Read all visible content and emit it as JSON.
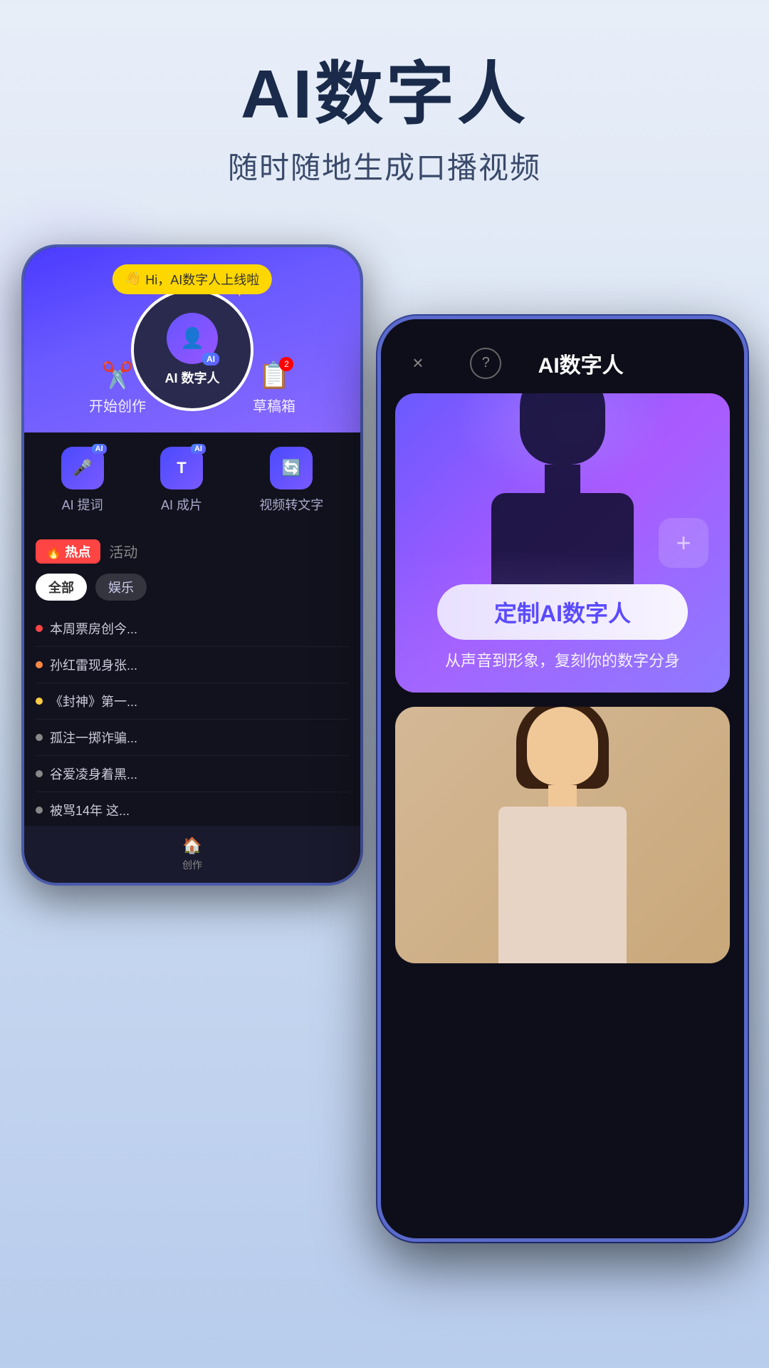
{
  "hero": {
    "title": "AI数字人",
    "subtitle": "随时随地生成口播视频"
  },
  "back_phone": {
    "notification": {
      "emoji": "👋",
      "text": "Hi，AI数字人上线啦"
    },
    "ai_circle_label": "AI 数字人",
    "main_actions": [
      {
        "icon": "✂️",
        "label": "开始创作"
      },
      {
        "icon": "📝",
        "label": "草稿箱",
        "badge": "2"
      }
    ],
    "tools": [
      {
        "icon": "🎤",
        "label": "AI 提词",
        "has_ai_badge": true
      },
      {
        "icon": "T",
        "label": "AI 成片",
        "has_ai_badge": true
      },
      {
        "icon": "🔄",
        "label": "视频转文字",
        "has_ai_badge": false
      }
    ],
    "hot_section": {
      "hot_label": "🔥热点",
      "tab_label": "活动",
      "filters": [
        "全部",
        "娱乐"
      ],
      "items": [
        {
          "dot_color": "red",
          "text": "本周票房创今..."
        },
        {
          "dot_color": "orange",
          "text": "孙红雷现身张..."
        },
        {
          "dot_color": "yellow",
          "text": "《封神》第一..."
        },
        {
          "dot_color": "gray",
          "text": "孤注一掷诈骗..."
        },
        {
          "dot_color": "gray",
          "text": "谷爱凌身着黑..."
        },
        {
          "dot_color": "gray",
          "text": "被骂14年 这..."
        }
      ]
    },
    "bottom_nav": {
      "icon": "🏠",
      "label": "创作"
    }
  },
  "front_phone": {
    "header": {
      "close_icon": "×",
      "help_icon": "?",
      "title": "AI数字人"
    },
    "digital_card": {
      "cta_label": "定制AI数字人",
      "description": "从声音到形象，复刻你的数字分身"
    },
    "person_card": {
      "alt": "female presenter"
    }
  }
}
